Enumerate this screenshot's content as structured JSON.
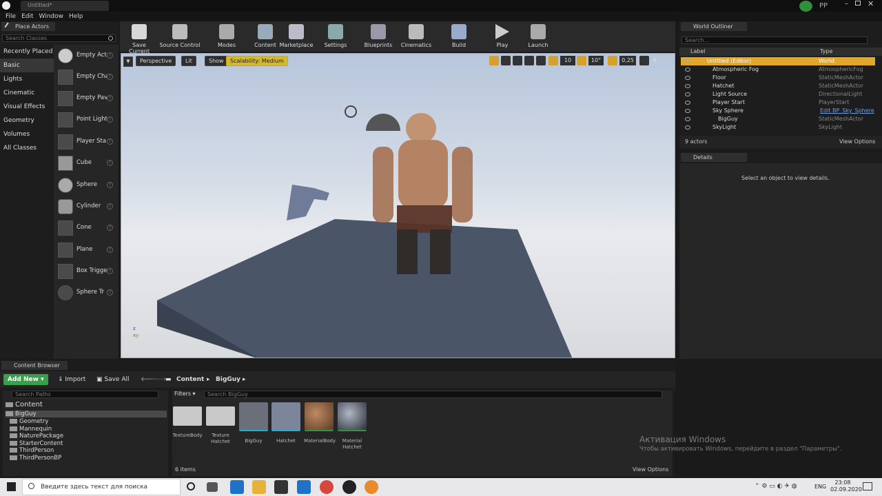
{
  "window": {
    "tab_title": "Untitled*",
    "user_initials": "PP"
  },
  "menu": [
    "File",
    "Edit",
    "Window",
    "Help"
  ],
  "place_actors": {
    "tab": "Place Actors",
    "search_placeholder": "Search Classes",
    "categories": [
      "Recently Placed",
      "Basic",
      "Lights",
      "Cinematic",
      "Visual Effects",
      "Geometry",
      "Volumes",
      "All Classes"
    ],
    "selected_category": "Basic",
    "items": [
      "Empty Act",
      "Empty Cha",
      "Empty Pav",
      "Point Light",
      "Player Sta",
      "Cube",
      "Sphere",
      "Cylinder",
      "Cone",
      "Plane",
      "Box Trigge",
      "Sphere Tr"
    ]
  },
  "toolbar": {
    "buttons": [
      "Save Current",
      "Source Control",
      "Modes",
      "Content",
      "Marketplace",
      "Settings",
      "Blueprints",
      "Cinematics",
      "Build",
      "Play",
      "Launch"
    ]
  },
  "viewport": {
    "perspective": "Perspective",
    "lit": "Lit",
    "show": "Show",
    "scalability": "Scalability: Medium",
    "grid_snap": "10",
    "rot_snap": "10°",
    "scale_snap": "0,25",
    "cam_speed": "4"
  },
  "outliner": {
    "tab": "World Outliner",
    "search_placeholder": "Search...",
    "col_label": "Label",
    "col_type": "Type",
    "rows": [
      {
        "label": "Untitled (Editor)",
        "type": "World"
      },
      {
        "label": "Atmospheric Fog",
        "type": "AtmosphericFog"
      },
      {
        "label": "Floor",
        "type": "StaticMeshActor"
      },
      {
        "label": "Hatchet",
        "type": "StaticMeshActor"
      },
      {
        "label": "Light Source",
        "type": "DirectionalLight"
      },
      {
        "label": "Player Start",
        "type": "PlayerStart"
      },
      {
        "label": "Sky Sphere",
        "type": "Edit BP_Sky_Sphere"
      },
      {
        "label": "BigGuy",
        "type": "StaticMeshActor"
      },
      {
        "label": "SkyLight",
        "type": "SkyLight"
      }
    ],
    "count": "9 actors",
    "view_options": "View Options"
  },
  "details": {
    "tab": "Details",
    "empty": "Select an object to view details."
  },
  "content_browser": {
    "tab": "Content Browser",
    "add_new": "Add New",
    "import": "Import",
    "save_all": "Save All",
    "path": [
      "Content",
      "BigGuy"
    ],
    "search_paths": "Search Paths",
    "filters": "Filters",
    "search_placeholder": "Search BigGuy",
    "tree_root": "Content",
    "tree": [
      "BigGuy",
      "Geometry",
      "Mannequin",
      "NaturePackage",
      "StarterContent",
      "ThirdPerson",
      "ThirdPersonBP"
    ],
    "assets": [
      "TextureBody",
      "Texture Hatchet",
      "BigGuy",
      "Hatchet",
      "MaterialBody",
      "Material Hatchet"
    ],
    "count": "6 items",
    "view_options": "View Options"
  },
  "watermark": {
    "title": "Активация Windows",
    "text": "Чтобы активировать Windows, перейдите в раздел \"Параметры\"."
  },
  "taskbar": {
    "search": "Введите здесь текст для поиска",
    "lang": "ENG",
    "time": "23:08",
    "date": "02.09.2020"
  }
}
